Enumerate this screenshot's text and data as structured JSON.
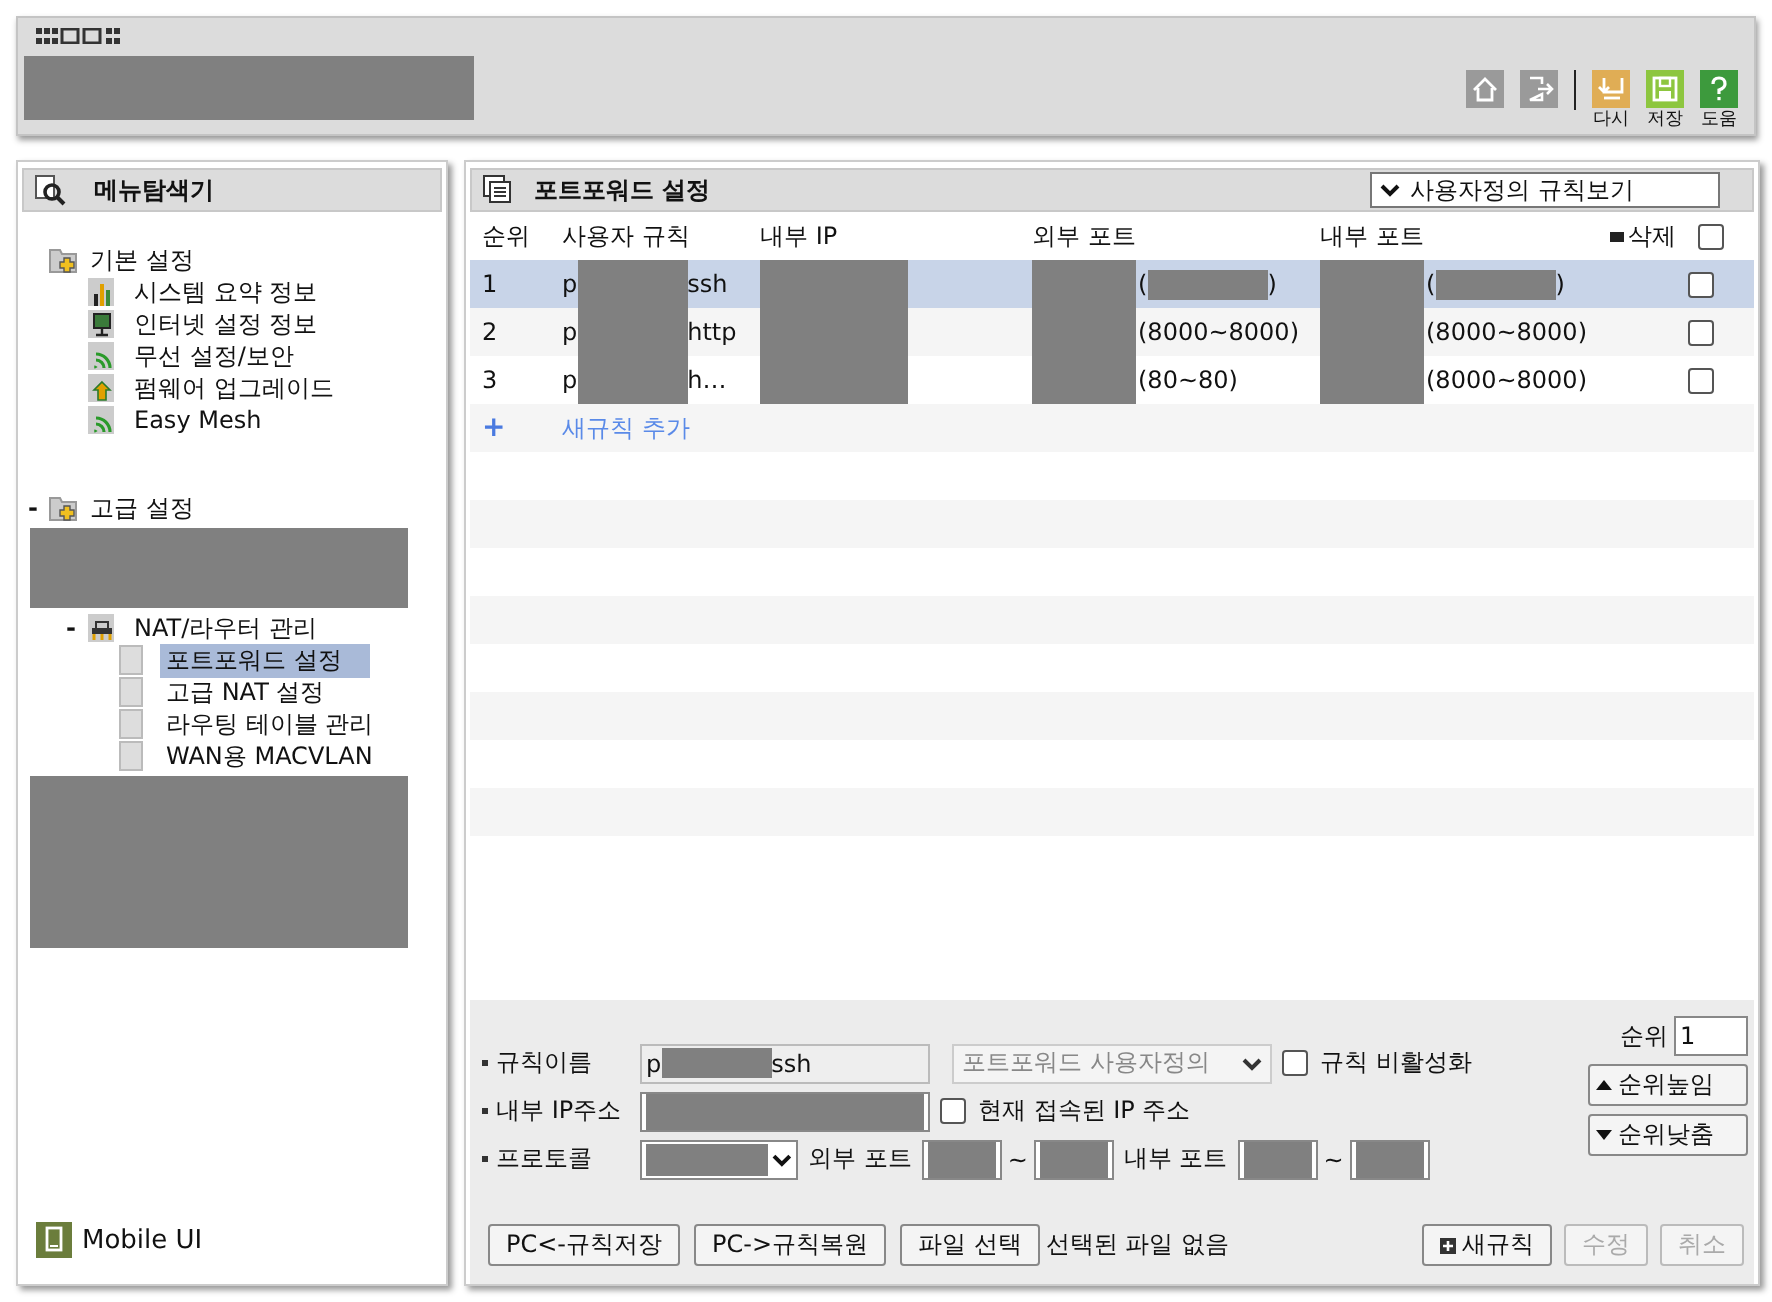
{
  "header": {
    "toolbar": [
      {
        "kind": "home"
      },
      {
        "kind": "logout"
      },
      {
        "kind": "undo",
        "label": "다시"
      },
      {
        "kind": "save",
        "label": "저장"
      },
      {
        "kind": "help",
        "label": "도움"
      }
    ]
  },
  "sidebar": {
    "title": "메뉴탐색기",
    "tree": [
      {
        "label": "기본 설정",
        "kind": "folder",
        "children": [
          {
            "label": "시스템 요약 정보",
            "kind": "chart",
            "selected": false
          },
          {
            "label": "인터넷 설정 정보",
            "kind": "monitor",
            "selected": false
          },
          {
            "label": "무선 설정/보안",
            "kind": "wifi",
            "selected": false
          },
          {
            "label": "펌웨어 업그레이드",
            "kind": "upload",
            "selected": false
          },
          {
            "label": "Easy Mesh",
            "kind": "wifi",
            "selected": false
          }
        ]
      },
      {
        "label": "고급 설정",
        "kind": "folder",
        "toggle": "-",
        "children": [
          {
            "kind": "redacted"
          },
          {
            "label": "NAT/라우터 관리",
            "kind": "router",
            "toggle": "-",
            "children": [
              {
                "label": "포트포워드 설정",
                "kind": "page",
                "selected": true
              },
              {
                "label": "고급 NAT 설정",
                "kind": "page",
                "selected": false
              },
              {
                "label": "라우팅 테이블 관리",
                "kind": "page",
                "selected": false
              },
              {
                "label": "WAN용 MACVLAN",
                "kind": "page",
                "selected": false
              }
            ]
          },
          {
            "kind": "redacted"
          }
        ]
      }
    ],
    "footer": {
      "label": "Mobile UI"
    }
  },
  "main": {
    "title": "포트포워드 설정",
    "view_select": "사용자정의 규칙보기",
    "columns": [
      "순위",
      "사용자 규칙",
      "내부 IP",
      "외부 포트",
      "내부 포트",
      "삭제"
    ],
    "select_all": {
      "checked": false
    },
    "rows": [
      {
        "rank": "1",
        "selected": true,
        "checked": false,
        "name": [
          {
            "kind": "text",
            "text": "p"
          },
          {
            "kind": "redacted"
          },
          {
            "kind": "text",
            "text": "ssh"
          }
        ],
        "ext": [
          {
            "kind": "text",
            "text": "("
          },
          {
            "kind": "redacted"
          },
          {
            "kind": "text",
            "text": ")"
          }
        ],
        "int": [
          {
            "kind": "text",
            "text": "("
          },
          {
            "kind": "redacted"
          },
          {
            "kind": "text",
            "text": ")"
          }
        ]
      },
      {
        "rank": "2",
        "selected": false,
        "checked": false,
        "name": [
          {
            "kind": "text",
            "text": "p"
          },
          {
            "kind": "redacted"
          },
          {
            "kind": "text",
            "text": "http"
          }
        ],
        "ext": [
          {
            "kind": "text",
            "text": "(8000~8000)"
          }
        ],
        "int": [
          {
            "kind": "text",
            "text": "(8000~8000)"
          }
        ]
      },
      {
        "rank": "3",
        "selected": false,
        "checked": false,
        "name": [
          {
            "kind": "text",
            "text": "p"
          },
          {
            "kind": "redacted"
          },
          {
            "kind": "text",
            "text": "h…"
          }
        ],
        "ext": [
          {
            "kind": "text",
            "text": "(80~80)"
          }
        ],
        "int": [
          {
            "kind": "text",
            "text": "(8000~8000)"
          }
        ]
      }
    ],
    "add_rule": {
      "icon": "+",
      "label": "새규칙 추가"
    },
    "form": {
      "rule_name": {
        "label": "규칙이름",
        "value": [
          {
            "kind": "text",
            "text": "p"
          },
          {
            "kind": "redacted"
          },
          {
            "kind": "text",
            "text": "ssh"
          }
        ]
      },
      "rule_type": {
        "value": "포트포워드 사용자정의",
        "disabled": true
      },
      "disable_rule": {
        "label": "규칙 비활성화",
        "checked": false
      },
      "internal_ip": {
        "label": "내부 IP주소"
      },
      "current_ip": {
        "label": "현재 접속된 IP 주소",
        "checked": false
      },
      "protocol": {
        "label": "프로토콜"
      },
      "external_port": {
        "label": "외부 포트",
        "separator": "~"
      },
      "internal_port": {
        "label": "내부 포트",
        "separator": "~"
      },
      "rank": {
        "label": "순위",
        "value": "1"
      },
      "rank_buttons": [
        {
          "kind": "up",
          "label": "순위높임"
        },
        {
          "kind": "down",
          "label": "순위낮춤"
        }
      ]
    },
    "bottom": {
      "left": [
        {
          "label": "PC<-규칙저장"
        },
        {
          "label": "PC->규칙복원"
        },
        {
          "label": "파일 선택"
        }
      ],
      "file_status": "선택된 파일 없음",
      "right": [
        {
          "label": "새규칙",
          "kind": "add",
          "disabled": false
        },
        {
          "label": "수정",
          "disabled": true
        },
        {
          "label": "취소",
          "disabled": true
        }
      ]
    }
  }
}
